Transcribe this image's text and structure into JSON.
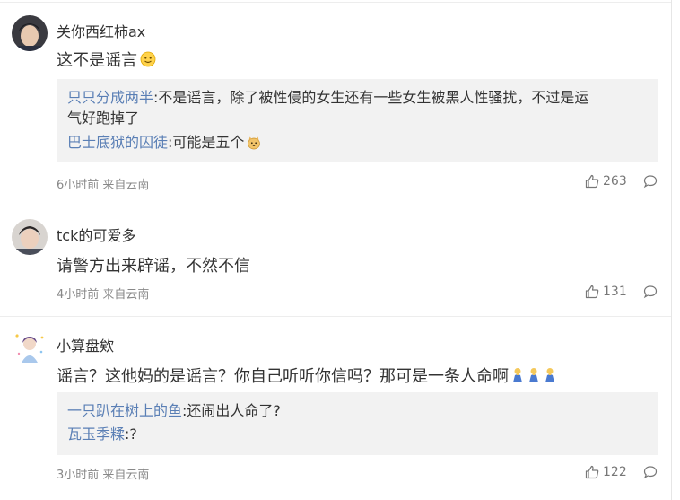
{
  "comments": [
    {
      "username": "关你西红柿ax",
      "text": "这不是谣言",
      "emoji": "smile-emoji",
      "replies": [
        {
          "name": "只只分成两半",
          "line1": ":不是谣言，除了被性侵的女生还有一些女生被黑人性骚扰，不过是运",
          "line2": "气好跑掉了"
        },
        {
          "name": "巴士底狱的囚徒",
          "line1": ":可能是五个",
          "emoji": "doge-emoji"
        }
      ],
      "meta": "6小时前 来自云南",
      "likes": "263"
    },
    {
      "username": "tck的可爱多",
      "text": "请警方出来辟谣，不然不信",
      "meta": "4小时前 来自云南",
      "likes": "131"
    },
    {
      "username": "小算盘欸",
      "text": "谣言？这他妈的是谣言？你自己听听你信吗？那可是一条人命啊",
      "emoji": "pray-emoji",
      "replies": [
        {
          "name": "一只趴在树上的鱼",
          "line1": ":还闹出人命了?"
        },
        {
          "name": "瓦玉季糅",
          "line1": ":?"
        }
      ],
      "meta": "3小时前 来自云南",
      "likes": "122"
    }
  ],
  "colors": {
    "reply_name": "#5a7fb5",
    "meta": "#888888",
    "reply_bg": "#f2f2f2"
  },
  "icons": {
    "like": "thumbs-up-icon",
    "reply": "comment-bubble-icon"
  }
}
